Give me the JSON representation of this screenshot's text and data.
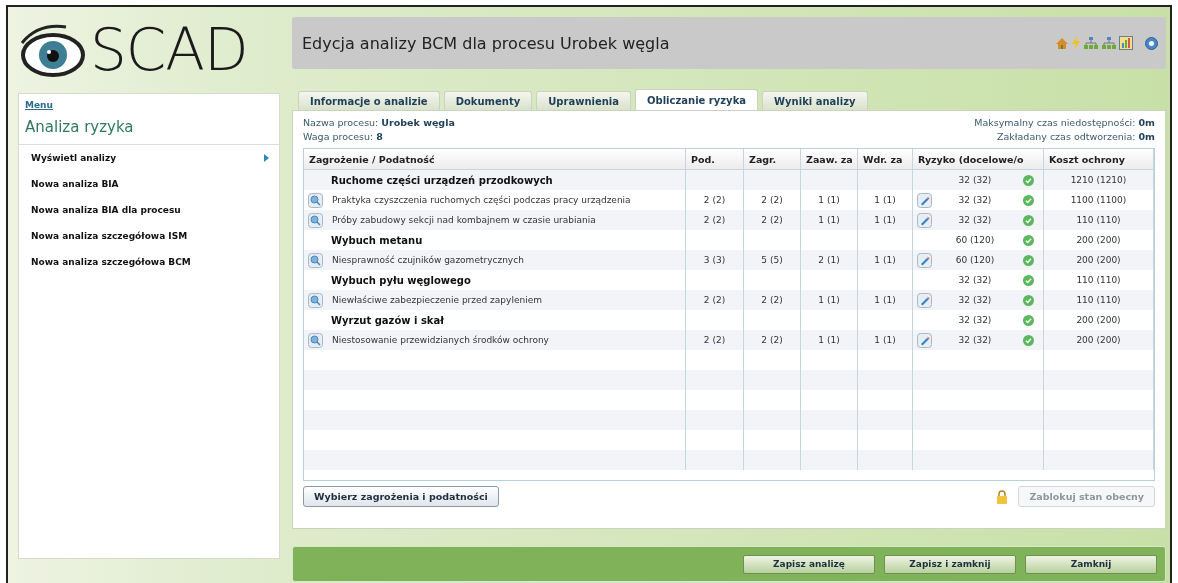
{
  "logo": {
    "text": "SCAD"
  },
  "header": {
    "title": "Edycja analizy BCM dla procesu Urobek węgla"
  },
  "sidebar": {
    "menu_link": "Menu",
    "title": "Analiza ryzyka",
    "items": [
      {
        "label": "Wyświetl analizy",
        "has_submenu": true
      },
      {
        "label": "Nowa analiza BIA",
        "has_submenu": false
      },
      {
        "label": "Nowa analiza BIA dla procesu",
        "has_submenu": false
      },
      {
        "label": "Nowa analiza szczegółowa ISM",
        "has_submenu": false
      },
      {
        "label": "Nowa analiza szczegółowa BCM",
        "has_submenu": false
      }
    ]
  },
  "tabs": [
    {
      "label": "Informacje o analizie",
      "selected": false
    },
    {
      "label": "Dokumenty",
      "selected": false
    },
    {
      "label": "Uprawnienia",
      "selected": false
    },
    {
      "label": "Obliczanie ryzyka",
      "selected": true
    },
    {
      "label": "Wyniki analizy",
      "selected": false
    }
  ],
  "process_info": [
    {
      "label": "Nazwa procesu:",
      "value": "Urobek węgla"
    },
    {
      "label": "Waga procesu:",
      "value": "8"
    }
  ],
  "time_info": [
    {
      "label": "Maksymalny czas niedostępności:",
      "value": "0m"
    },
    {
      "label": "Zakładany czas odtworzenia:",
      "value": "0m"
    }
  ],
  "table": {
    "columns": [
      "Zagrożenie / Podatność",
      "Pod.",
      "Zagr.",
      "Zaaw. za",
      "Wdr. za",
      "Ryzyko (docelowe/o",
      "Koszt ochrony"
    ],
    "rows": [
      {
        "kind": "group",
        "name": "Ruchome części urządzeń przodkowych",
        "risk": "32 (32)",
        "cost": "1210 (1210)"
      },
      {
        "kind": "item",
        "name": "Praktyka czyszczenia ruchomych części podczas pracy urządzenia",
        "pod": "2 (2)",
        "zagr": "2 (2)",
        "zaaw": "1 (1)",
        "wdr": "1 (1)",
        "risk": "32 (32)",
        "cost": "1100 (1100)"
      },
      {
        "kind": "item",
        "name": "Próby zabudowy sekcji nad kombajnem w czasie urabiania",
        "pod": "2 (2)",
        "zagr": "2 (2)",
        "zaaw": "1 (1)",
        "wdr": "1 (1)",
        "risk": "32 (32)",
        "cost": "110 (110)"
      },
      {
        "kind": "group",
        "name": "Wybuch metanu",
        "risk": "60 (120)",
        "cost": "200 (200)"
      },
      {
        "kind": "item",
        "name": "Niesprawność czujników gazometrycznych",
        "pod": "3 (3)",
        "zagr": "5 (5)",
        "zaaw": "2 (1)",
        "wdr": "1 (1)",
        "risk": "60 (120)",
        "cost": "200 (200)"
      },
      {
        "kind": "group",
        "name": "Wybuch pyłu węglowego",
        "risk": "32 (32)",
        "cost": "110 (110)"
      },
      {
        "kind": "item",
        "name": "Niewłaściwe  zabezpieczenie przed zapyleniem",
        "pod": "2 (2)",
        "zagr": "2 (2)",
        "zaaw": "1 (1)",
        "wdr": "1 (1)",
        "risk": "32 (32)",
        "cost": "110 (110)"
      },
      {
        "kind": "group",
        "name": "Wyrzut gazów i skał",
        "risk": "32 (32)",
        "cost": "200 (200)"
      },
      {
        "kind": "item",
        "name": "Niestosowanie przewidzianych środków ochrony",
        "pod": "2 (2)",
        "zagr": "2 (2)",
        "zaaw": "1 (1)",
        "wdr": "1 (1)",
        "risk": "32 (32)",
        "cost": "200 (200)"
      }
    ]
  },
  "actions": {
    "select_button": "Wybierz zagrożenia i podatności",
    "lock_button": {
      "label": "Zablokuj stan obecny",
      "disabled": true
    }
  },
  "footer_buttons": [
    "Zapisz analizę",
    "Zapisz i zamknij",
    "Zamknij"
  ]
}
